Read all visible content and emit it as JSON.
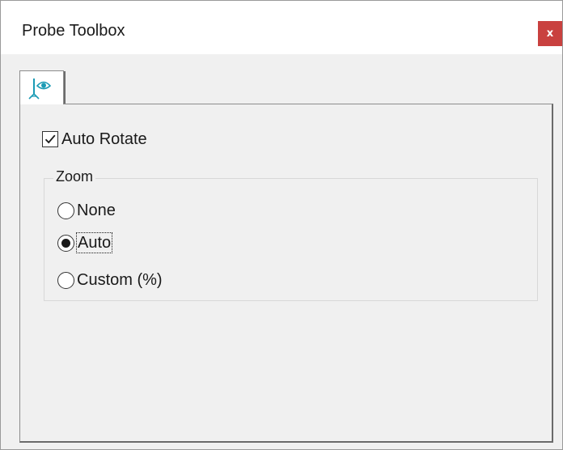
{
  "window": {
    "title": "Probe Toolbox",
    "close_label": "x",
    "close_color": "#c9413f"
  },
  "tabs": [
    {
      "icon": "probe-eye-icon",
      "active": true,
      "accent": "#1b9bb5"
    }
  ],
  "auto_rotate": {
    "label": "Auto Rotate",
    "checked": true
  },
  "zoom": {
    "title": "Zoom",
    "options": [
      {
        "label": "None",
        "selected": false
      },
      {
        "label": "Auto",
        "selected": true,
        "focused": true
      },
      {
        "label": "Custom (%)",
        "selected": false
      }
    ]
  }
}
